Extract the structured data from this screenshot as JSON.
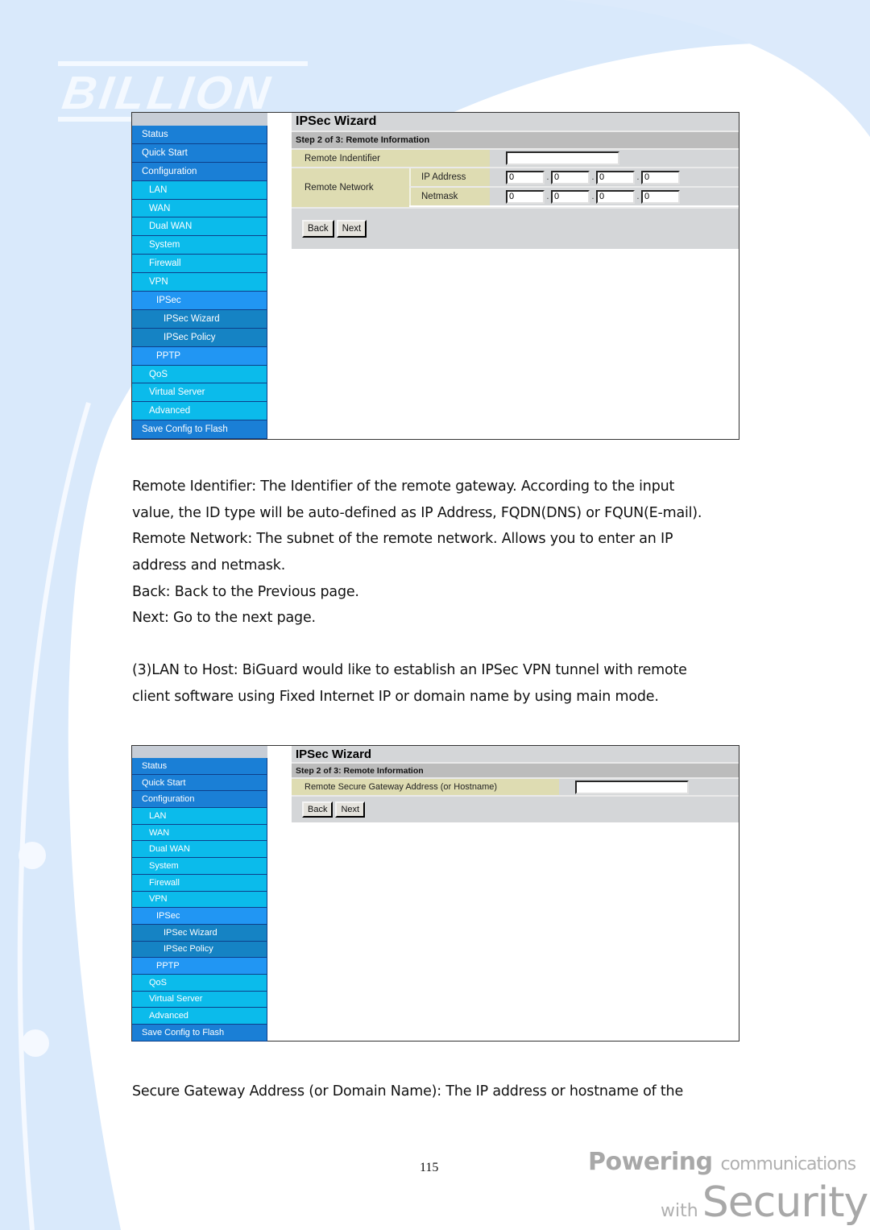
{
  "brand": {
    "logo_text": "BILLION",
    "tagline_word1": "Powering",
    "tagline_word2": "communications",
    "tagline_word3": "with",
    "tagline_word4": "Security"
  },
  "sidebar": {
    "items": [
      {
        "label": "Status",
        "level": 0
      },
      {
        "label": "Quick Start",
        "level": 0
      },
      {
        "label": "Configuration",
        "level": 0
      },
      {
        "label": "LAN",
        "level": 1
      },
      {
        "label": "WAN",
        "level": 1
      },
      {
        "label": "Dual WAN",
        "level": 1
      },
      {
        "label": "System",
        "level": 1
      },
      {
        "label": "Firewall",
        "level": 1
      },
      {
        "label": "VPN",
        "level": 1
      },
      {
        "label": "IPSec",
        "level": 2
      },
      {
        "label": "IPSec Wizard",
        "level": 3
      },
      {
        "label": "IPSec Policy",
        "level": 3
      },
      {
        "label": "PPTP",
        "level": 2
      },
      {
        "label": "QoS",
        "level": 1
      },
      {
        "label": "Virtual Server",
        "level": 1
      },
      {
        "label": "Advanced",
        "level": 1
      },
      {
        "label": "Save Config to Flash",
        "level": 0
      }
    ]
  },
  "screen1": {
    "title": "IPSec Wizard",
    "step": "Step 2 of 3: Remote Information",
    "remote_identifier_label": "Remote Indentifier",
    "remote_identifier_value": "",
    "remote_network_label": "Remote Network",
    "ip_address_label": "IP Address",
    "ip_address_octets": [
      "0",
      "0",
      "0",
      "0"
    ],
    "netmask_label": "Netmask",
    "netmask_octets": [
      "0",
      "0",
      "0",
      "0"
    ],
    "separator": ".",
    "back_label": "Back",
    "next_label": "Next"
  },
  "description1": {
    "lines": [
      "Remote Identifier: The Identifier of the remote gateway. According to the input",
      "value, the ID type will be auto-defined as IP Address, FQDN(DNS) or FQUN(E-mail).",
      "Remote Network: The subnet of the remote network. Allows you to enter an IP",
      "address and netmask.",
      "Back: Back to the Previous page.",
      "Next: Go to the next page."
    ]
  },
  "description2": {
    "lines": [
      "(3)LAN to Host: BiGuard would like to establish an IPSec VPN tunnel with remote",
      "client software using Fixed Internet IP or domain name by using main mode."
    ]
  },
  "screen2": {
    "title": "IPSec Wizard",
    "step": "Step 2 of 3: Remote Information",
    "gateway_label": "Remote Secure Gateway Address (or Hostname)",
    "gateway_value": "",
    "back_label": "Back",
    "next_label": "Next"
  },
  "description3": {
    "lines": [
      "Secure Gateway Address (or Domain Name): The IP address or hostname of the"
    ]
  },
  "page_number": "115"
}
